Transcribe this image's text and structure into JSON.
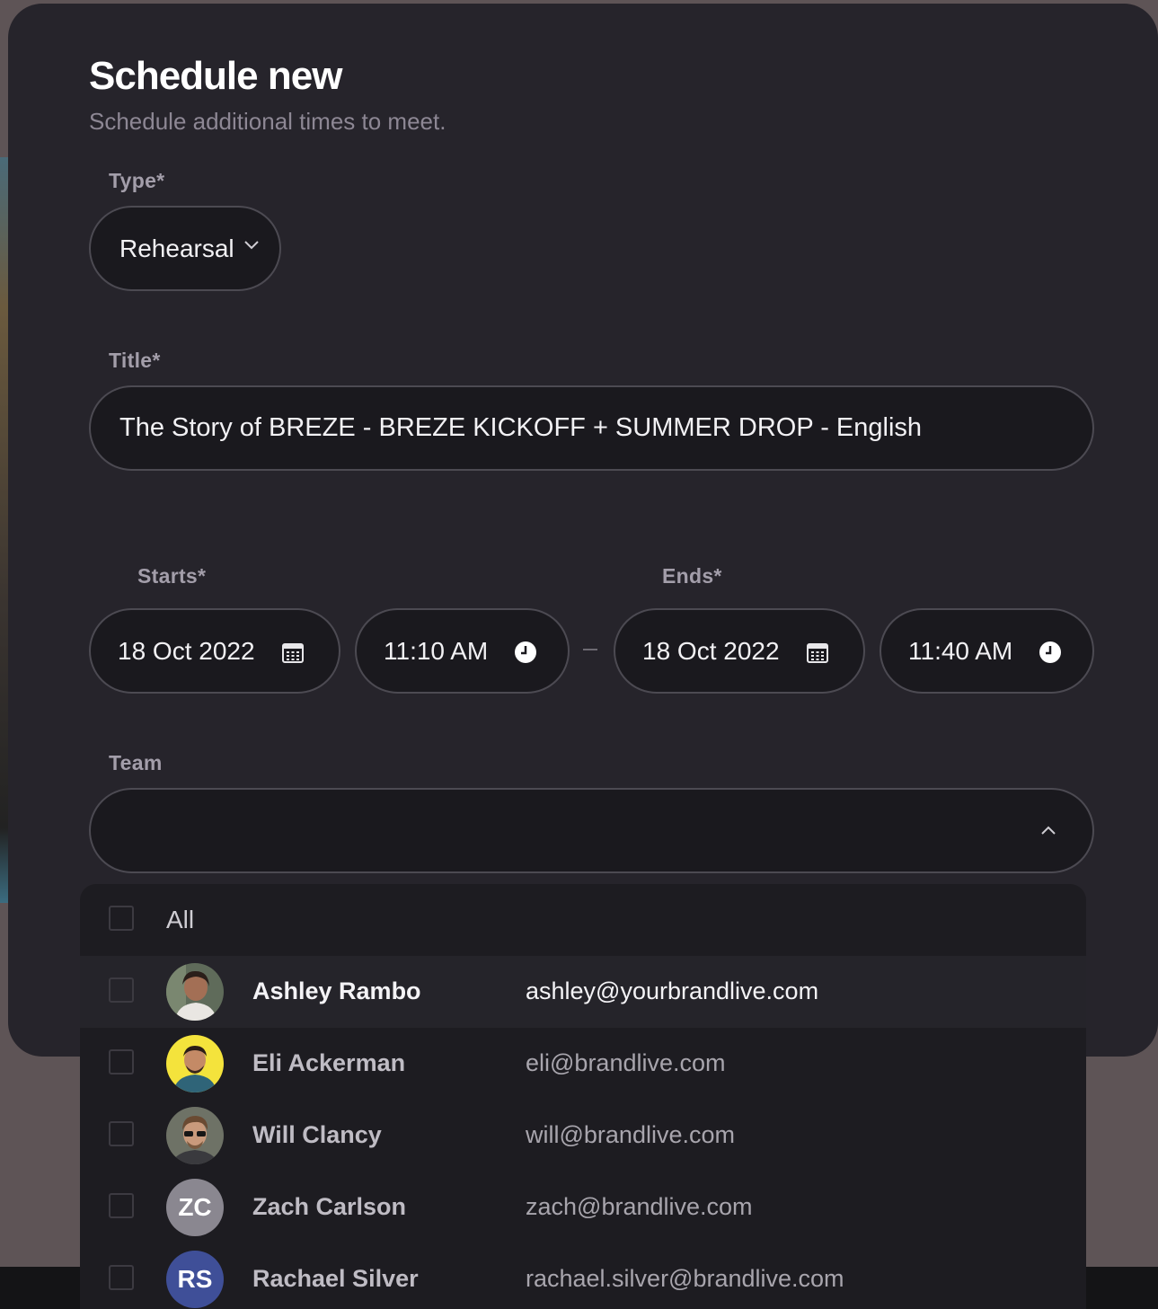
{
  "dialog": {
    "title": "Schedule new",
    "subtitle": "Schedule additional times to meet."
  },
  "type_field": {
    "label": "Type*",
    "value": "Rehearsal",
    "icon": "chevron-down-icon"
  },
  "title_field": {
    "label": "Title*",
    "value": "The Story of BREZE - BREZE KICKOFF + SUMMER DROP - English"
  },
  "starts": {
    "label": "Starts*",
    "date": "18 Oct 2022",
    "time": "11:10 AM"
  },
  "ends": {
    "label": "Ends*",
    "date": "18 Oct 2022",
    "time": "11:40 AM"
  },
  "team_field": {
    "label": "Team",
    "value": "",
    "icon": "chevron-up-icon"
  },
  "team_dropdown": {
    "all_label": "All",
    "members": [
      {
        "name": "Ashley Rambo",
        "email": "ashley@yourbrandlive.com",
        "avatar": "photo",
        "highlighted": true
      },
      {
        "name": "Eli Ackerman",
        "email": "eli@brandlive.com",
        "avatar": "photo"
      },
      {
        "name": "Will Clancy",
        "email": "will@brandlive.com",
        "avatar": "photo"
      },
      {
        "name": "Zach Carlson",
        "email": "zach@brandlive.com",
        "avatar": "initials",
        "initials": "ZC",
        "avatar_color": "#8a8790"
      },
      {
        "name": "Rachael Silver",
        "email": "rachael.silver@brandlive.com",
        "avatar": "initials",
        "initials": "RS",
        "avatar_color": "#3f4f98"
      }
    ]
  }
}
